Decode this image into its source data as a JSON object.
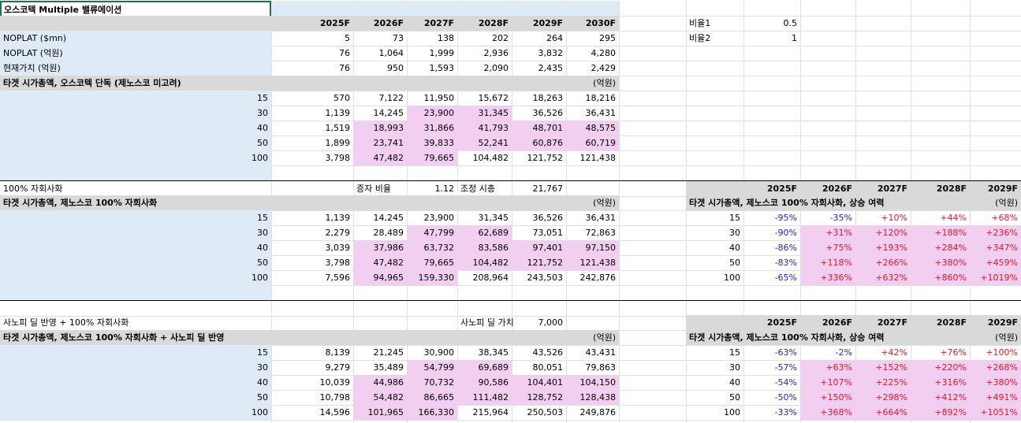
{
  "sheet_title": "오스코텍 Multiple 밸류에이션",
  "years": [
    "2025F",
    "2026F",
    "2027F",
    "2028F",
    "2029F",
    "2030F"
  ],
  "ratio": {
    "label1": "비율1",
    "value1": "0.5",
    "label2": "비율2",
    "value2": "1"
  },
  "base": {
    "rows": [
      {
        "label": "NOPLAT ($mn)",
        "values": [
          "5",
          "73",
          "138",
          "202",
          "264",
          "295"
        ]
      },
      {
        "label": "NOPLAT (억원)",
        "values": [
          "76",
          "1,064",
          "1,999",
          "2,936",
          "3,832",
          "4,280"
        ]
      },
      {
        "label": "현재가치 (억원)",
        "values": [
          "76",
          "950",
          "1,593",
          "2,090",
          "2,435",
          "2,429"
        ]
      }
    ]
  },
  "section1": {
    "header": "타겟 시가총액, 오스코텍 단독 (제노스코 미고려)",
    "unit": "(억원)",
    "rows": [
      {
        "mult": "15",
        "values": [
          "570",
          "7,122",
          "11,950",
          "15,672",
          "18,263",
          "18,216"
        ]
      },
      {
        "mult": "30",
        "values": [
          "1,139",
          "14,245",
          "23,900",
          "31,345",
          "36,526",
          "36,431"
        ]
      },
      {
        "mult": "40",
        "values": [
          "1,519",
          "18,993",
          "31,866",
          "41,793",
          "48,701",
          "48,575"
        ]
      },
      {
        "mult": "50",
        "values": [
          "1,899",
          "23,741",
          "39,833",
          "52,241",
          "60,876",
          "60,719"
        ]
      },
      {
        "mult": "100",
        "values": [
          "3,798",
          "47,482",
          "79,665",
          "104,482",
          "121,752",
          "121,438"
        ]
      }
    ]
  },
  "section2": {
    "title": "100% 자회사화",
    "ratio_label": "증자 비율",
    "ratio_value": "1.12",
    "adj_label": "조정 시총",
    "adj_value": "21,767",
    "header": "타겟 시가총액, 제노스코 100% 자회사화",
    "unit": "(억원)",
    "rows": [
      {
        "mult": "15",
        "values": [
          "1,139",
          "14,245",
          "23,900",
          "31,345",
          "36,526",
          "36,431"
        ]
      },
      {
        "mult": "30",
        "values": [
          "2,279",
          "28,489",
          "47,799",
          "62,689",
          "73,051",
          "72,863"
        ]
      },
      {
        "mult": "40",
        "values": [
          "3,039",
          "37,986",
          "63,732",
          "83,586",
          "97,401",
          "97,150"
        ]
      },
      {
        "mult": "50",
        "values": [
          "3,798",
          "47,482",
          "79,665",
          "104,482",
          "121,752",
          "121,438"
        ]
      },
      {
        "mult": "100",
        "values": [
          "7,596",
          "94,965",
          "159,330",
          "208,964",
          "243,503",
          "242,876"
        ]
      }
    ],
    "upside": {
      "years": [
        "2025F",
        "2026F",
        "2027F",
        "2028F",
        "2029F"
      ],
      "header": "타겟 시가총액, 제노스코 100% 자회사화, 상승 여력",
      "unit": "(억원)",
      "rows": [
        {
          "mult": "15",
          "values": [
            "-95%",
            "-35%",
            "+10%",
            "+44%",
            "+68%"
          ]
        },
        {
          "mult": "30",
          "values": [
            "-90%",
            "+31%",
            "+120%",
            "+188%",
            "+236%"
          ]
        },
        {
          "mult": "40",
          "values": [
            "-86%",
            "+75%",
            "+193%",
            "+284%",
            "+347%"
          ]
        },
        {
          "mult": "50",
          "values": [
            "-83%",
            "+118%",
            "+266%",
            "+380%",
            "+459%"
          ]
        },
        {
          "mult": "100",
          "values": [
            "-65%",
            "+336%",
            "+632%",
            "+860%",
            "+1019%"
          ]
        }
      ]
    }
  },
  "section3": {
    "title": "사노피 딜 반영 + 100% 자회사화",
    "deal_label": "사노피 딜 가치",
    "deal_value": "7,000",
    "header": "타겟 시가총액, 제노스코 100% 자회사화 + 사노피 딜 반영",
    "unit": "(억원)",
    "rows": [
      {
        "mult": "15",
        "values": [
          "8,139",
          "21,245",
          "30,900",
          "38,345",
          "43,526",
          "43,431"
        ]
      },
      {
        "mult": "30",
        "values": [
          "9,279",
          "35,489",
          "54,799",
          "69,689",
          "80,051",
          "79,863"
        ]
      },
      {
        "mult": "40",
        "values": [
          "10,039",
          "44,986",
          "70,732",
          "90,586",
          "104,401",
          "104,150"
        ]
      },
      {
        "mult": "50",
        "values": [
          "10,798",
          "54,482",
          "86,665",
          "111,482",
          "128,752",
          "128,438"
        ]
      },
      {
        "mult": "100",
        "values": [
          "14,596",
          "101,965",
          "166,330",
          "215,964",
          "250,503",
          "249,876"
        ]
      }
    ],
    "upside": {
      "years": [
        "2025F",
        "2026F",
        "2027F",
        "2028F",
        "2029F"
      ],
      "header": "타겟 시가총액, 제노스코 100% 자회사화, 상승 여력",
      "unit": "(억원)",
      "rows": [
        {
          "mult": "15",
          "values": [
            "-63%",
            "-2%",
            "+42%",
            "+76%",
            "+100%"
          ]
        },
        {
          "mult": "30",
          "values": [
            "-57%",
            "+63%",
            "+152%",
            "+220%",
            "+268%"
          ]
        },
        {
          "mult": "40",
          "values": [
            "-54%",
            "+107%",
            "+225%",
            "+316%",
            "+380%"
          ]
        },
        {
          "mult": "50",
          "values": [
            "-50%",
            "+150%",
            "+298%",
            "+412%",
            "+491%"
          ]
        },
        {
          "mult": "100",
          "values": [
            "-33%",
            "+368%",
            "+664%",
            "+892%",
            "+1051%"
          ]
        }
      ]
    }
  },
  "colors": {
    "label_bg": "#deeaf6",
    "header_bg": "#d9d9d9",
    "highlight": "#f2cef0",
    "negative": "#1f1fd6",
    "positive": "#e8182f",
    "selection": "#217346"
  }
}
